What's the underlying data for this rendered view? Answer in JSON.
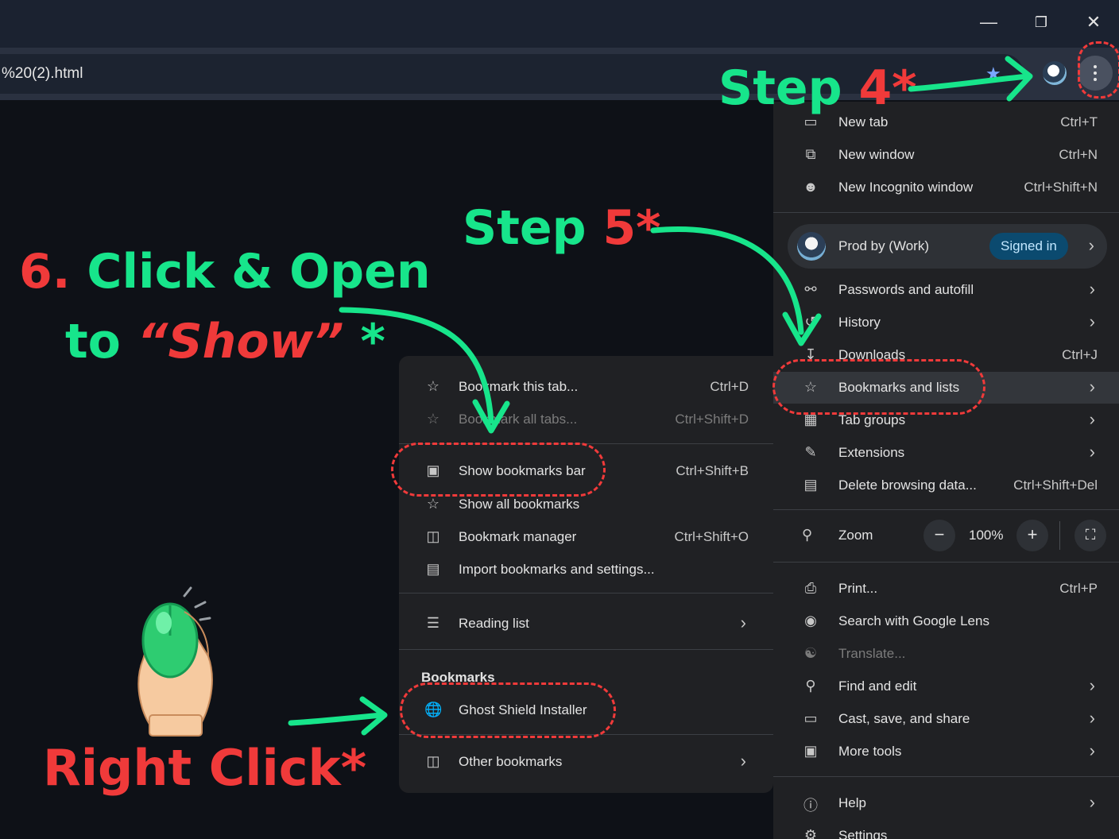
{
  "window": {
    "minimize_icon": "minimize-icon",
    "restore_icon": "restore-icon",
    "close_icon": "close-icon"
  },
  "toolbar": {
    "url": "%20(2).html",
    "star_icon": "bookmark-star-icon",
    "menu_icon": "three-dots-menu-icon"
  },
  "main_menu": {
    "items": [
      {
        "label": "New tab",
        "shortcut": "Ctrl+T",
        "icon": "new-tab-icon"
      },
      {
        "label": "New window",
        "shortcut": "Ctrl+N",
        "icon": "new-window-icon"
      },
      {
        "label": "New Incognito window",
        "shortcut": "Ctrl+Shift+N",
        "icon": "incognito-icon"
      }
    ],
    "profile": {
      "name": "Prod by (Work)",
      "status": "Signed in"
    },
    "items2": [
      {
        "label": "Passwords and autofill",
        "icon": "key-icon"
      },
      {
        "label": "History",
        "icon": "history-icon"
      },
      {
        "label": "Downloads",
        "shortcut": "Ctrl+J",
        "icon": "download-icon"
      },
      {
        "label": "Bookmarks and lists",
        "icon": "star-icon"
      },
      {
        "label": "Tab groups",
        "icon": "tab-groups-icon"
      },
      {
        "label": "Extensions",
        "icon": "puzzle-icon"
      },
      {
        "label": "Delete browsing data...",
        "shortcut": "Ctrl+Shift+Del",
        "icon": "trash-icon"
      }
    ],
    "zoom": {
      "label": "Zoom",
      "value": "100%",
      "minus": "−",
      "plus": "+"
    },
    "items3": [
      {
        "label": "Print...",
        "shortcut": "Ctrl+P",
        "icon": "print-icon"
      },
      {
        "label": "Search with Google Lens",
        "icon": "lens-icon"
      },
      {
        "label": "Translate...",
        "icon": "translate-icon"
      },
      {
        "label": "Find and edit",
        "icon": "find-icon"
      },
      {
        "label": "Cast, save, and share",
        "icon": "cast-icon"
      },
      {
        "label": "More tools",
        "icon": "toolbox-icon"
      }
    ],
    "items4": [
      {
        "label": "Help",
        "icon": "help-icon"
      },
      {
        "label": "Settings",
        "icon": "settings-icon"
      }
    ]
  },
  "sub_menu": {
    "items": [
      {
        "label": "Bookmark this tab...",
        "shortcut": "Ctrl+D"
      },
      {
        "label": "Bookmark all tabs...",
        "shortcut": "Ctrl+Shift+D"
      },
      {
        "label": "Show bookmarks bar",
        "shortcut": "Ctrl+Shift+B"
      },
      {
        "label": "Show all bookmarks"
      },
      {
        "label": "Bookmark manager",
        "shortcut": "Ctrl+Shift+O"
      },
      {
        "label": "Import bookmarks and settings..."
      },
      {
        "label": "Reading list"
      }
    ],
    "heading": "Bookmarks",
    "bookmark": {
      "label": "Ghost Shield Installer"
    },
    "other": {
      "label": "Other bookmarks"
    }
  },
  "annotations": {
    "step4_word": "Step ",
    "step4_num": "4*",
    "step5_word": "Step ",
    "step5_num": "5*",
    "six_num": "6.",
    "six_text": " Click & Open",
    "to_word": "to ",
    "show_word": "“Show”",
    "show_star": " *",
    "right_click": "Right Click*"
  },
  "colors": {
    "annotation_green": "#17e58b",
    "annotation_red": "#f03a3a",
    "menu_bg": "#202124",
    "highlight": "#33363b",
    "signed_in_pill": "#0b4a6f"
  }
}
